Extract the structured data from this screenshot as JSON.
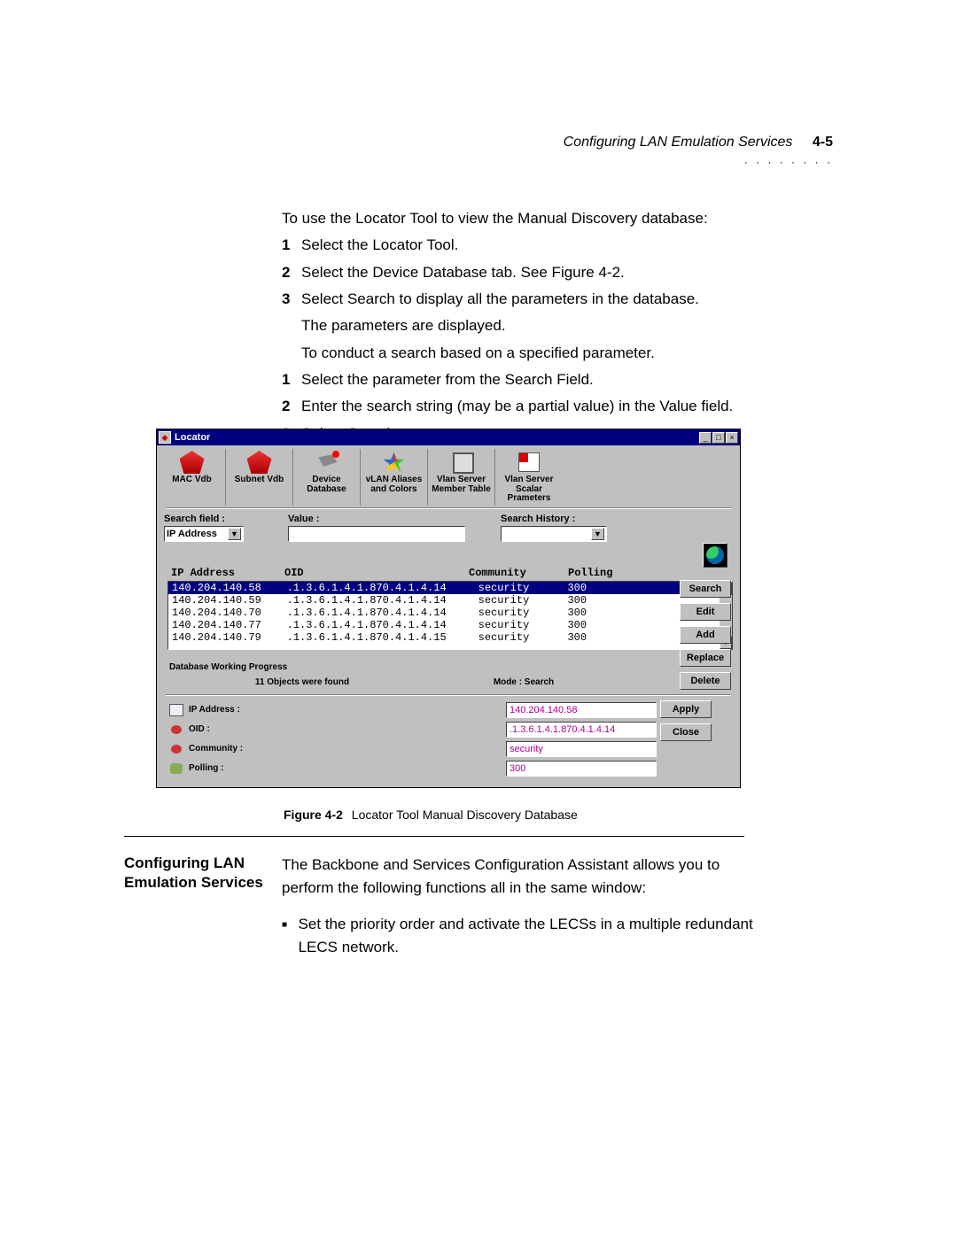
{
  "header": {
    "chapter_title": "Configuring LAN Emulation Services",
    "page_number": "4-5"
  },
  "intro": "To use the Locator Tool to view the Manual Discovery database:",
  "steps_a": [
    "Select the Locator Tool.",
    "Select the Device Database tab. See Figure 4-2.",
    "Select Search to display all the parameters in the database."
  ],
  "after_a": [
    "The parameters are displayed.",
    "To conduct a search based on a specified parameter."
  ],
  "steps_b": [
    "Select the parameter from the Search Field.",
    "Enter the search string (may be a partial value) in the Value field.",
    "Select Search."
  ],
  "locator": {
    "title": "Locator",
    "toolbar": [
      {
        "name": "mac-vdb",
        "label": "MAC Vdb"
      },
      {
        "name": "subnet-vdb",
        "label": "Subnet Vdb"
      },
      {
        "name": "device-database",
        "label": "Device Database"
      },
      {
        "name": "vlan-aliases",
        "label": "vLAN Aliases\nand Colors"
      },
      {
        "name": "vlan-member",
        "label": "Vlan Server\nMember Table"
      },
      {
        "name": "vlan-scalar",
        "label": "Vlan Server\nScalar Prameters"
      }
    ],
    "search_field_label": "Search field :",
    "value_label": "Value :",
    "history_label": "Search History :",
    "search_field_value": "IP Address",
    "columns": {
      "ip": "IP Address",
      "oid": "OID",
      "community": "Community",
      "polling": "Polling"
    },
    "rows": [
      {
        "ip": "140.204.140.58",
        "oid": ".1.3.6.1.4.1.870.4.1.4.14",
        "community": "security",
        "polling": "300",
        "selected": true
      },
      {
        "ip": "140.204.140.59",
        "oid": ".1.3.6.1.4.1.870.4.1.4.14",
        "community": "security",
        "polling": "300"
      },
      {
        "ip": "140.204.140.70",
        "oid": ".1.3.6.1.4.1.870.4.1.4.14",
        "community": "security",
        "polling": "300"
      },
      {
        "ip": "140.204.140.77",
        "oid": ".1.3.6.1.4.1.870.4.1.4.14",
        "community": "security",
        "polling": "300"
      },
      {
        "ip": "140.204.140.79",
        "oid": ".1.3.6.1.4.1.870.4.1.4.15",
        "community": "security",
        "polling": "300"
      }
    ],
    "side_buttons": [
      "Search",
      "Edit",
      "Add",
      "Replace",
      "Delete"
    ],
    "dwp_label": "Database Working Progress",
    "found_text": "11 Objects were found",
    "mode_text": "Mode : Search",
    "detail_labels": {
      "ip": "IP Address :",
      "oid": "OID :",
      "community": "Community :",
      "polling": "Polling :"
    },
    "detail_values": {
      "ip": "140.204.140.58",
      "oid": ".1.3.6.1.4.1.870.4.1.4.14",
      "community": "security",
      "polling": "300"
    },
    "detail_buttons": [
      "Apply",
      "Close"
    ]
  },
  "figure_caption_bold": "Figure 4-2",
  "figure_caption_text": "Locator Tool Manual Discovery Database",
  "section2": {
    "title": "Configuring LAN Emulation Services",
    "para": "The Backbone and Services Configuration Assistant allows you to perform the following functions all in the same window:",
    "bullet": "Set the priority order and activate the LECSs in a multiple redundant LECS network."
  }
}
